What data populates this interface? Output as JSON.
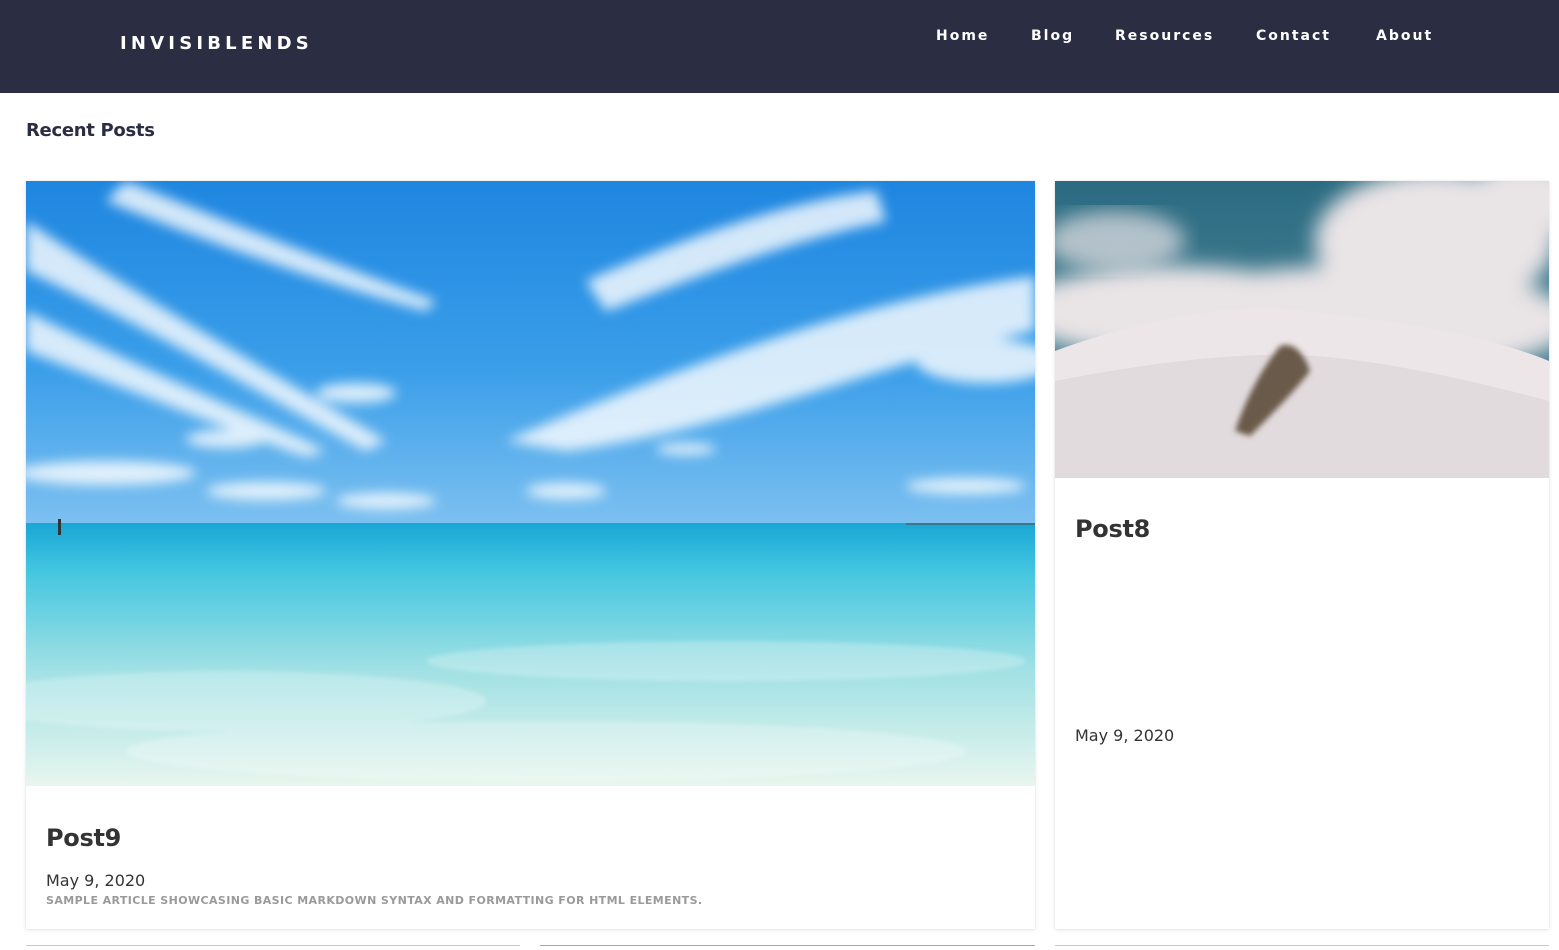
{
  "header": {
    "brand": "INVISIBLENDS",
    "nav": [
      {
        "label": "Home"
      },
      {
        "label": "Blog"
      },
      {
        "label": "Resources"
      },
      {
        "label": "Contact"
      },
      {
        "label": "About"
      }
    ]
  },
  "main": {
    "section_title": "Recent Posts",
    "posts": [
      {
        "title": "Post9",
        "date": "May 9, 2020",
        "summary": "SAMPLE ARTICLE SHOWCASING BASIC MARKDOWN SYNTAX AND FORMATTING FOR HTML ELEMENTS.",
        "image": "beach-sea-sky-photo"
      },
      {
        "title": "Post8",
        "date": "May 9, 2020",
        "image": "snowy-mountain-photo"
      }
    ]
  },
  "colors": {
    "header_bg": "#2b2d42",
    "header_text": "#ffffff",
    "title_text": "#333333",
    "summary_text": "#9a9a9a"
  }
}
